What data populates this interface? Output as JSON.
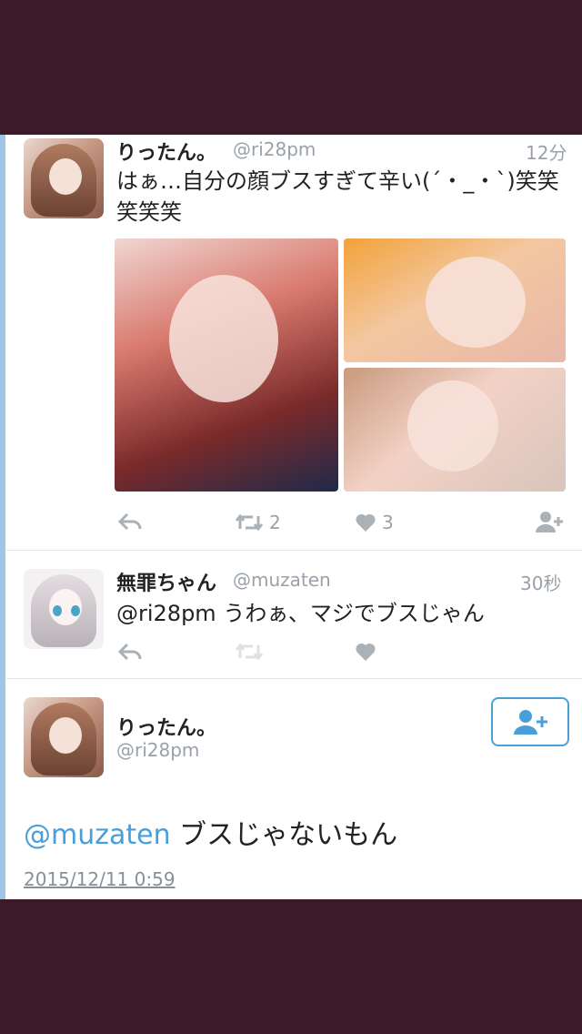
{
  "tweet1": {
    "name": "りったん。",
    "handle": "@ri28pm",
    "time": "12分",
    "text_line1": "はぁ…自分の顔ブスすぎて辛い(´・_・`)笑笑",
    "text_line2": "笑笑笑",
    "retweet_count": "2",
    "like_count": "3"
  },
  "tweet2": {
    "name": "無罪ちゃん",
    "handle": "@muzaten",
    "time": "30秒",
    "text": "@ri28pm うわぁ、マジでブスじゃん"
  },
  "tweet3": {
    "name": "りったん。",
    "handle": "@ri28pm",
    "mention": "@muzaten",
    "text": "ブスじゃないもん",
    "date": "2015/12/11 0:59"
  },
  "icons": [
    "reply-icon",
    "retweet-icon",
    "like-icon",
    "follow-icon"
  ],
  "colors": {
    "accent": "#4a9fd9",
    "background": "#3b1a2a",
    "muted": "#9aa1a8"
  }
}
